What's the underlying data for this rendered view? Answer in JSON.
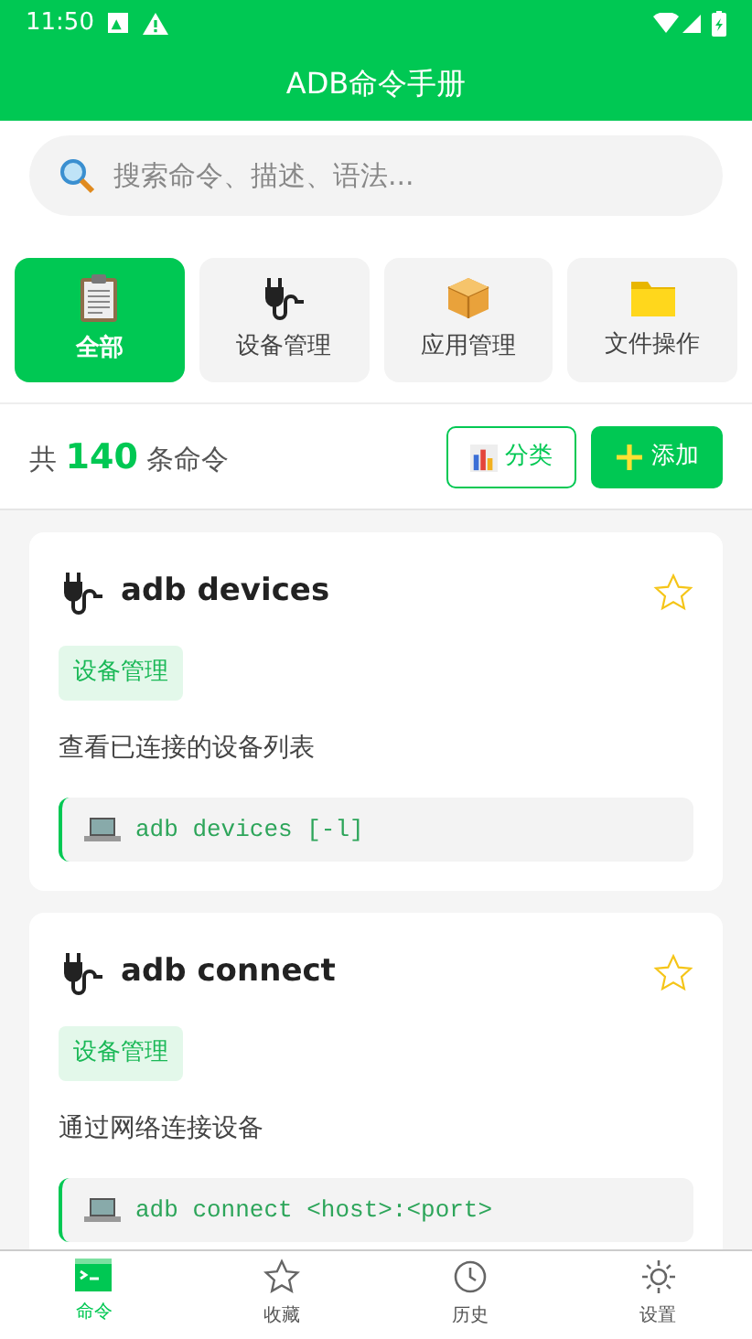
{
  "status_bar": {
    "time": "11:50"
  },
  "app_bar": {
    "title": "ADB命令手册"
  },
  "search": {
    "placeholder": "搜索命令、描述、语法..."
  },
  "categories": [
    {
      "label": "全部",
      "selected": true
    },
    {
      "label": "设备管理",
      "selected": false
    },
    {
      "label": "应用管理",
      "selected": false
    },
    {
      "label": "文件操作",
      "selected": false
    }
  ],
  "summary": {
    "prefix": "共",
    "count": "140",
    "suffix": "条命令"
  },
  "actions": [
    {
      "kind": "outline",
      "label": "分类"
    },
    {
      "kind": "solid",
      "label": "添加"
    }
  ],
  "commands": [
    {
      "title": "adb devices",
      "favorite": false,
      "tag": "设备管理",
      "description": "查看已连接的设备列表",
      "syntax": "adb devices [-l]"
    },
    {
      "title": "adb connect",
      "favorite": false,
      "tag": "设备管理",
      "description": "通过网络连接设备",
      "syntax": "adb connect <host>:<port>"
    }
  ],
  "bottom_nav": [
    {
      "label": "命令",
      "selected": true
    },
    {
      "label": "收藏",
      "selected": false
    },
    {
      "label": "历史",
      "selected": false
    },
    {
      "label": "设置",
      "selected": false
    }
  ]
}
